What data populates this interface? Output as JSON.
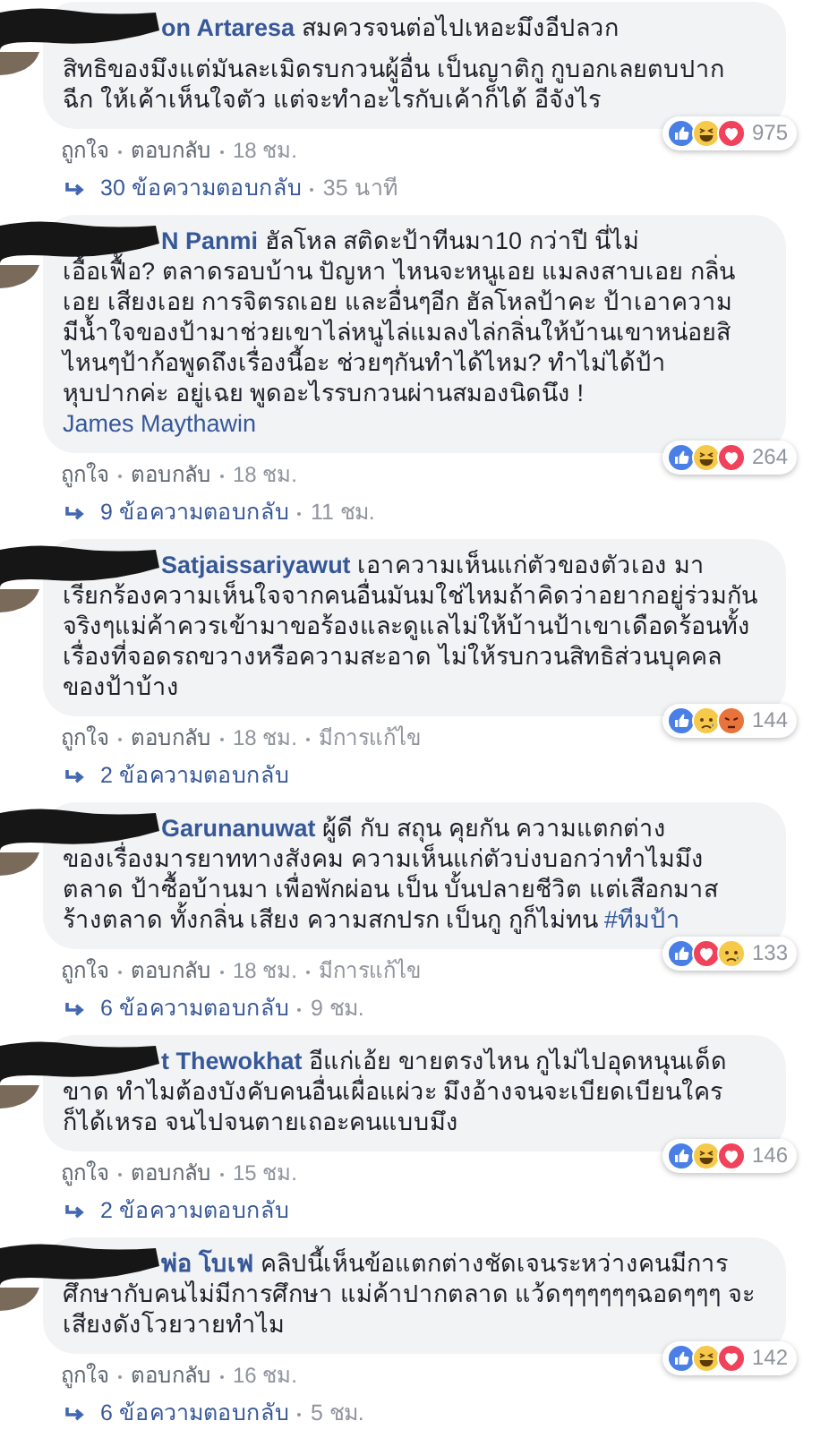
{
  "comments": [
    {
      "name": "on Artaresa",
      "paragraphs": [
        [
          "สมควรจนต่อไปเหอะมึงอีปลวก"
        ],
        [
          "สิทธิของมึงแต่มันละเมิดรบกวนผู้อื่น เป็นญาติกู กูบอกเลยตบปาก",
          "ฉีก ให้เค้าเห็นใจตัว แต่จะทำอะไรกับเค้าก็ได้ อีจังไร"
        ]
      ],
      "reactions": [
        {
          "kind": "like"
        },
        {
          "kind": "haha"
        },
        {
          "kind": "love"
        }
      ],
      "count": "975",
      "like": "ถูกใจ",
      "reply": "ตอบกลับ",
      "time": "18 ชม.",
      "replies": {
        "label": "30 ข้อความตอบกลับ",
        "time": "35 นาที"
      }
    },
    {
      "name": "N Panmi",
      "paragraphs": [
        [
          "ฮัลโหล สติดะป้าทีนมา10 กว่าปี นี่ไม่",
          "เอื้อเฟื้อ? ตลาดรอบบ้าน ปัญหา ไหนจะหนูเอย แมลงสาบเอย กลิ่น",
          "เอย เสียงเอย การจิตรถเอย และอื่นๆอีก ฮัลโหลป้าคะ ป้าเอาความ",
          "มีน้ำใจของป้ามาช่วยเขาไล่หนูไล่แมลงไล่กลิ่นให้บ้านเขาหน่อยสิ",
          "ไหนๆป้าก้อพูดถึงเรื่องนี้อะ ช่วยๆกันทำได้ไหม? ทำไม่ได้ป้า",
          "หุบปากค่ะ อยู่เฉย พูดอะไรรบกวนผ่านสมองนิดนึง !"
        ]
      ],
      "link": "James Maythawin",
      "reactions": [
        {
          "kind": "like"
        },
        {
          "kind": "haha"
        },
        {
          "kind": "love"
        }
      ],
      "count": "264",
      "like": "ถูกใจ",
      "reply": "ตอบกลับ",
      "time": "18 ชม.",
      "replies": {
        "label": "9 ข้อความตอบกลับ",
        "time": "11 ชม."
      }
    },
    {
      "name": "Satjaissariyawut",
      "paragraphs": [
        [
          "เอาความเห็นแก่ตัวของตัวเอง มา",
          "เรียกร้องความเห็นใจจากคนอื่นมันมใช่ไหมถ้าคิดว่าอยากอยู่ร่วมกัน",
          "จริงๆแม่ค้าควรเข้ามาขอร้องและดูแลไม่ให้บ้านป้าเขาเดือดร้อนทั้ง",
          "เรื่องที่จอดรถขวางหรือความสะอาด ไม่ให้รบกวนสิทธิส่วนบุคคล",
          "ของป้าบ้าง"
        ]
      ],
      "reactions": [
        {
          "kind": "like"
        },
        {
          "kind": "sad"
        },
        {
          "kind": "angry"
        }
      ],
      "count": "144",
      "like": "ถูกใจ",
      "reply": "ตอบกลับ",
      "time": "18 ชม.",
      "edited": "มีการแก้ไข",
      "replies": {
        "label": "2 ข้อความตอบกลับ"
      }
    },
    {
      "name": "Garunanuwat",
      "paragraphs": [
        [
          "ผู้ดี กับ สถุน คุยกัน ความแตกต่าง",
          "ของเรื่องมารยาททางสังคม ความเห็นแก่ตัวบ่งบอกว่าทำไมมึง",
          "ตลาด ป้าซื้อบ้านมา เพื่อพักผ่อน เป็น บั้นปลายชีวิต แต่เสือกมาส",
          "ร้างตลาด ทั้งกลิ่น เสียง ความสกปรก เป็นกู กูก็ไม่ทน"
        ]
      ],
      "link": "#ทีมป้า",
      "reactions": [
        {
          "kind": "like"
        },
        {
          "kind": "love"
        },
        {
          "kind": "sad"
        }
      ],
      "count": "133",
      "like": "ถูกใจ",
      "reply": "ตอบกลับ",
      "time": "18 ชม.",
      "edited": "มีการแก้ไข",
      "replies": {
        "label": "6 ข้อความตอบกลับ",
        "time": "9 ชม."
      }
    },
    {
      "name": "t Thewokhat",
      "paragraphs": [
        [
          "อีแก่เอ้ย ขายตรงไหน กูไม่ไปอุดหนุนเด็ด",
          "ขาด ทำไมต้องบังคับคนอื่นเผื่อแผ่วะ มึงอ้างจนจะเบียดเบียนใคร",
          "ก็ได้เหรอ จนไปจนตายเถอะคนแบบมึง"
        ]
      ],
      "reactions": [
        {
          "kind": "like"
        },
        {
          "kind": "haha"
        },
        {
          "kind": "love"
        }
      ],
      "count": "146",
      "like": "ถูกใจ",
      "reply": "ตอบกลับ",
      "time": "15 ชม.",
      "replies": {
        "label": "2 ข้อความตอบกลับ"
      }
    },
    {
      "name": "พ่อ โบเฟ",
      "paragraphs": [
        [
          "คลิปนี้เห็นข้อแตกต่างชัดเจนระหว่างคนมีการ",
          "ศึกษากับคนไม่มีการศึกษา แม่ค้าปากตลาด แว้ดๆๆๆๆๆๆฉอดๆๆๆ จะ",
          "เสียงดังโวยวายทำไม"
        ]
      ],
      "reactions": [
        {
          "kind": "like"
        },
        {
          "kind": "haha"
        },
        {
          "kind": "love"
        }
      ],
      "count": "142",
      "like": "ถูกใจ",
      "reply": "ตอบกลับ",
      "time": "16 ชม.",
      "replies": {
        "label": "6 ข้อความตอบกลับ",
        "time": "5 ชม."
      }
    }
  ]
}
